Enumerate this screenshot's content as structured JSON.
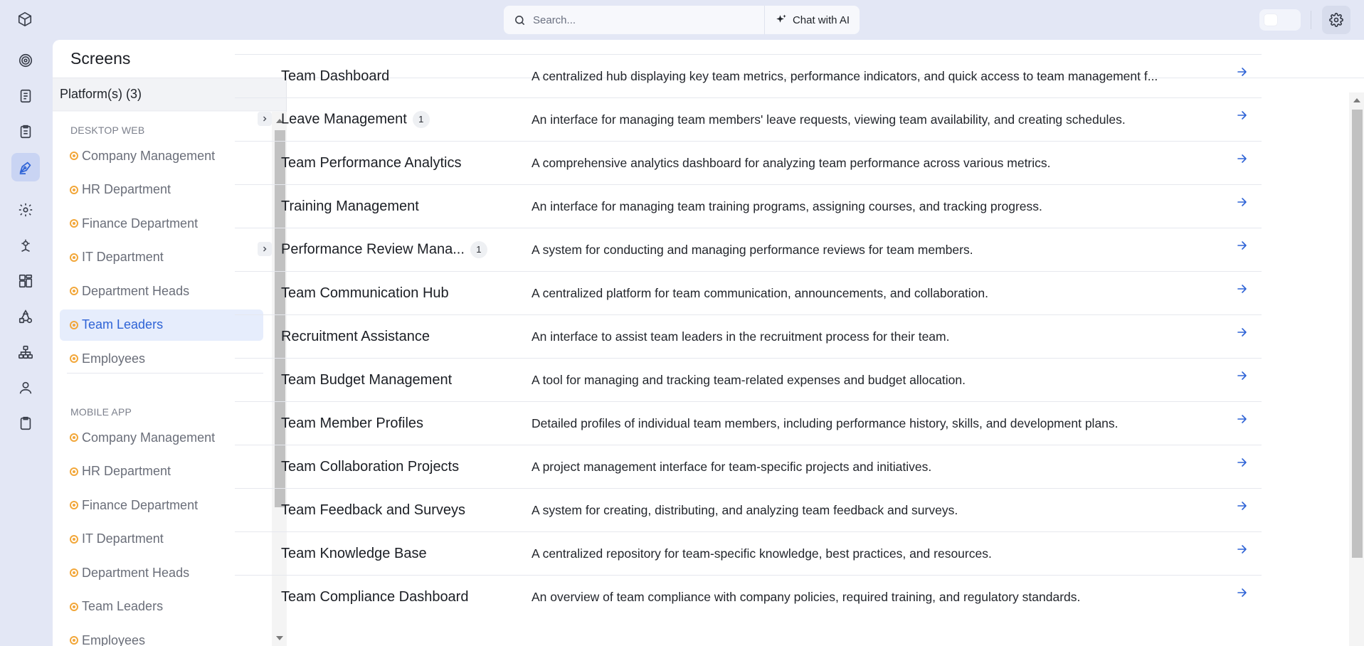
{
  "topbar": {
    "search_placeholder": "Search...",
    "chat_label": "Chat with AI"
  },
  "rail": {
    "icons": [
      "cube-logo-icon",
      "target-icon",
      "document-icon",
      "clipboard-list-icon",
      "pen-tool-icon",
      "gear-icon",
      "cog-network-icon",
      "grid-icon",
      "flow-icon",
      "sitemap-icon",
      "user-icon",
      "clipboard-icon"
    ],
    "active": "pen-tool-icon"
  },
  "page": {
    "title": "Screens"
  },
  "platforms": {
    "header": "Platform(s) (3)",
    "groups": [
      {
        "label": "DESKTOP WEB",
        "items": [
          "Company Management",
          "HR Department",
          "Finance Department",
          "IT Department",
          "Department Heads",
          "Team Leaders",
          "Employees"
        ],
        "active_index": 5
      },
      {
        "label": "MOBILE APP",
        "items": [
          "Company Management",
          "HR Department",
          "Finance Department",
          "IT Department",
          "Department Heads",
          "Team Leaders",
          "Employees"
        ],
        "active_index": null
      }
    ]
  },
  "screens": [
    {
      "name": "Team Dashboard",
      "desc": "A centralized hub displaying key team metrics, performance indicators, and quick access to team management f...",
      "children": null
    },
    {
      "name": "Leave Management",
      "desc": "An interface for managing team members' leave requests, viewing team availability, and creating schedules.",
      "children": "1"
    },
    {
      "name": "Team Performance Analytics",
      "desc": "A comprehensive analytics dashboard for analyzing team performance across various metrics.",
      "children": null
    },
    {
      "name": "Training Management",
      "desc": "An interface for managing team training programs, assigning courses, and tracking progress.",
      "children": null
    },
    {
      "name": "Performance Review Mana...",
      "desc": "A system for conducting and managing performance reviews for team members.",
      "children": "1"
    },
    {
      "name": "Team Communication Hub",
      "desc": "A centralized platform for team communication, announcements, and collaboration.",
      "children": null
    },
    {
      "name": "Recruitment Assistance",
      "desc": "An interface to assist team leaders in the recruitment process for their team.",
      "children": null
    },
    {
      "name": "Team Budget Management",
      "desc": "A tool for managing and tracking team-related expenses and budget allocation.",
      "children": null
    },
    {
      "name": "Team Member Profiles",
      "desc": "Detailed profiles of individual team members, including performance history, skills, and development plans.",
      "children": null
    },
    {
      "name": "Team Collaboration Projects",
      "desc": "A project management interface for team-specific projects and initiatives.",
      "children": null
    },
    {
      "name": "Team Feedback and Surveys",
      "desc": "A system for creating, distributing, and analyzing team feedback and surveys.",
      "children": null
    },
    {
      "name": "Team Knowledge Base",
      "desc": "A centralized repository for team-specific knowledge, best practices, and resources.",
      "children": null
    },
    {
      "name": "Team Compliance Dashboard",
      "desc": "An overview of team compliance with company policies, required training, and regulatory standards.",
      "children": null
    }
  ],
  "colors": {
    "accent": "#2e63d6",
    "status_dot": "#f2a73a",
    "active_bg": "#e6edfc"
  }
}
